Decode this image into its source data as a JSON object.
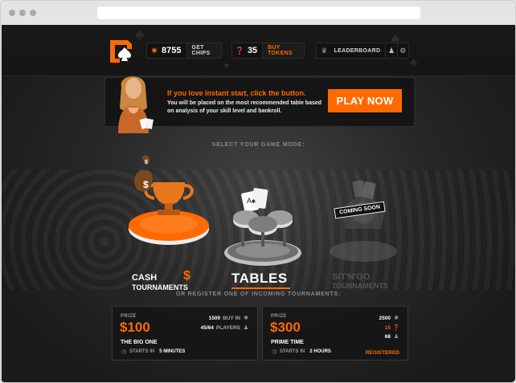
{
  "topbar": {
    "chips": "8755",
    "get_chips_label": "GET CHIPS",
    "tokens": "35",
    "buy_tokens_label": "BUY TOKENS",
    "leaderboard_label": "LEADERBOARD"
  },
  "banner": {
    "title": "If you love instant start, click the button.",
    "body": "You will be placed on the most recommended table based on analysis of your skill level and bankroll.",
    "play_label": "PLAY NOW"
  },
  "modes": {
    "section_label": "SELECT YOUR GAME MODE:",
    "cash_line1": "CASH",
    "cash_line2": "TOURNAMENTS",
    "cash_symbol": "$",
    "tables_label": "TABLES",
    "sitngo_line1": "SIT'N'GO",
    "sitngo_line2": "TOURNAMENTS",
    "coming_soon": "COMING SOON"
  },
  "tournaments": {
    "section_label": "OR REGISTER ONE OF INCOMING TOURNAMENTS:",
    "items": [
      {
        "prize_label": "PRIZE",
        "prize": "$100",
        "buy_in": "1500",
        "buy_in_label": "BUY IN",
        "players": "45/64",
        "players_label": "PLAYERS",
        "name": "THE BIG ONE",
        "starts_label": "STARTS IN",
        "starts_value": "5 MINUTES"
      },
      {
        "prize_label": "PRIZE",
        "prize": "$300",
        "buy_in": "2500",
        "tokens": "15",
        "players": "68",
        "name": "PRIME TIME",
        "starts_label": "STARTS IN",
        "starts_value": "2 HOURS",
        "status": "REGISTERED"
      }
    ]
  },
  "colors": {
    "accent": "#ff6a00",
    "background": "#1e1e1e"
  }
}
